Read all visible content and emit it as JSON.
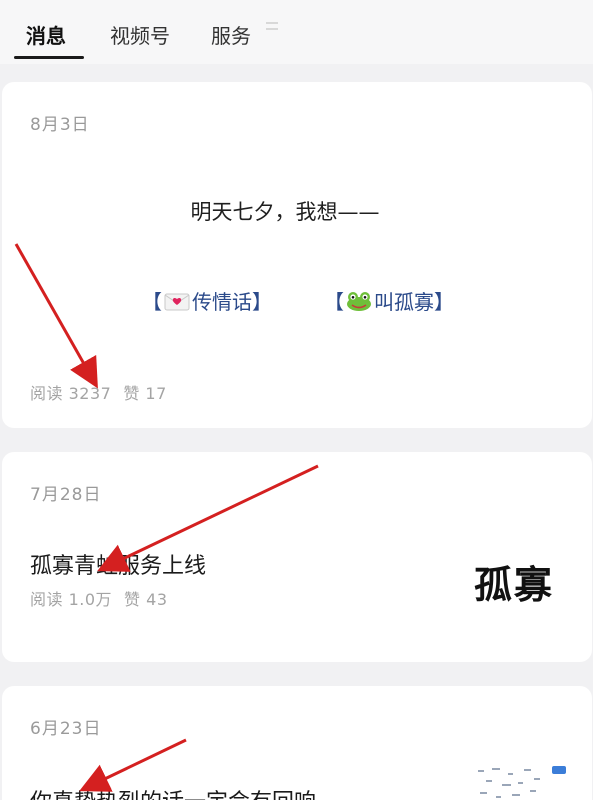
{
  "tabs": [
    {
      "label": "消息",
      "active": true
    },
    {
      "label": "视频号",
      "active": false
    },
    {
      "label": "服务",
      "active": false
    }
  ],
  "cards": [
    {
      "date": "8月3日",
      "title": "明天七夕，我想——",
      "links": [
        {
          "label": "传情话",
          "icon": "love-letter-icon"
        },
        {
          "label": "叫孤寡",
          "icon": "frog-icon"
        }
      ],
      "reads": "阅读 3237",
      "likes": "赞 17"
    },
    {
      "date": "7月28日",
      "title": "孤寡青蛙服务上线",
      "reads": "阅读 1.0万",
      "likes": "赞 43",
      "thumbnail_text": "孤寡"
    },
    {
      "date": "6月23日",
      "title": "你真挚热烈的话一定会有回响"
    }
  ],
  "colors": {
    "background": "#f1f1f3",
    "card": "#ffffff",
    "link": "#2b4a8a",
    "annotation_arrow": "#d42020"
  }
}
